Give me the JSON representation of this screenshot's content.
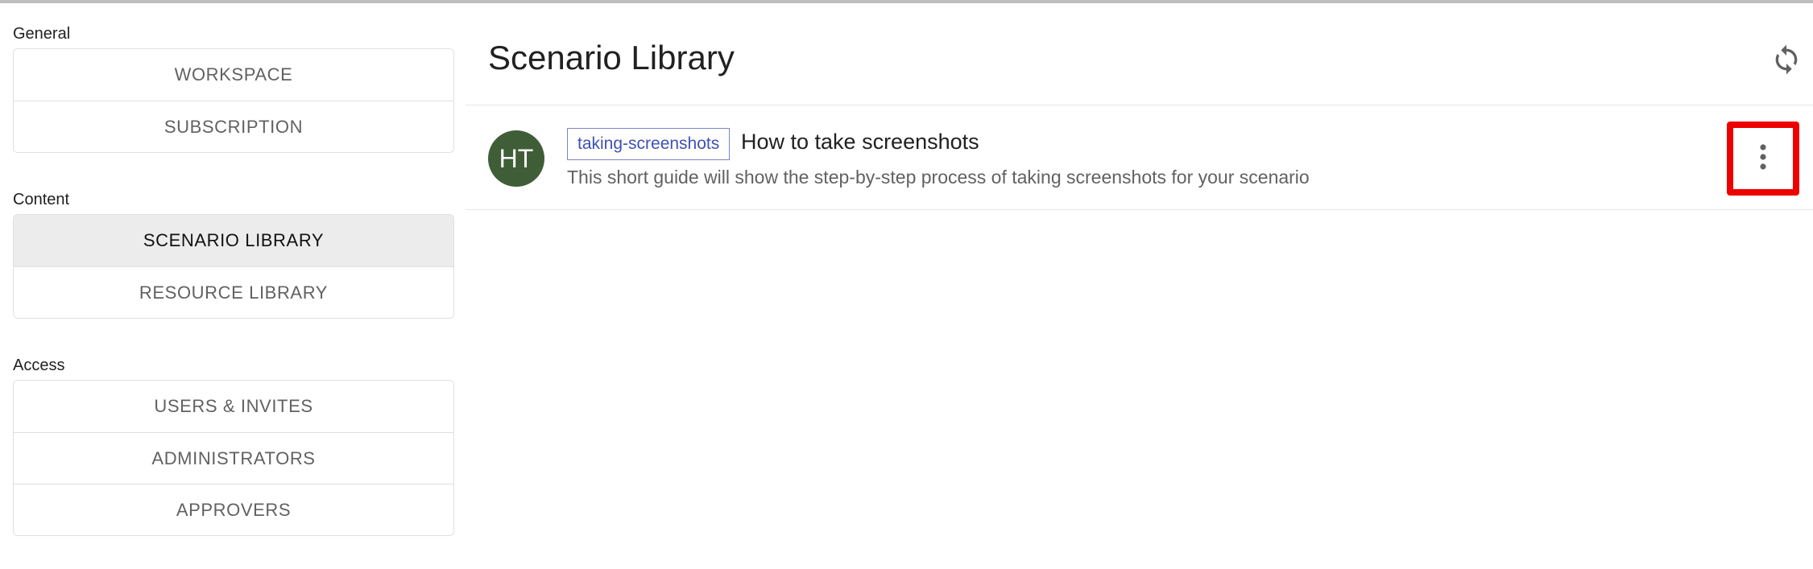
{
  "sidebar": {
    "sections": [
      {
        "label": "General",
        "items": [
          {
            "label": "WORKSPACE"
          },
          {
            "label": "SUBSCRIPTION"
          }
        ]
      },
      {
        "label": "Content",
        "items": [
          {
            "label": "SCENARIO LIBRARY",
            "active": true
          },
          {
            "label": "RESOURCE LIBRARY"
          }
        ]
      },
      {
        "label": "Access",
        "items": [
          {
            "label": "USERS & INVITES"
          },
          {
            "label": "ADMINISTRATORS"
          },
          {
            "label": "APPROVERS"
          }
        ]
      }
    ]
  },
  "main": {
    "title": "Scenario Library",
    "refresh_icon": "refresh-icon",
    "scenarios": [
      {
        "avatar_initials": "HT",
        "avatar_color": "#3f5e38",
        "tag": "taking-screenshots",
        "title": "How to take screenshots",
        "description": "This short guide will show the step-by-step process of taking screenshots for your scenario",
        "menu_icon": "more-vertical-icon"
      }
    ]
  },
  "colors": {
    "accent": "#3f51b5",
    "highlight": "#ee0000",
    "active_bg": "#ececec"
  }
}
